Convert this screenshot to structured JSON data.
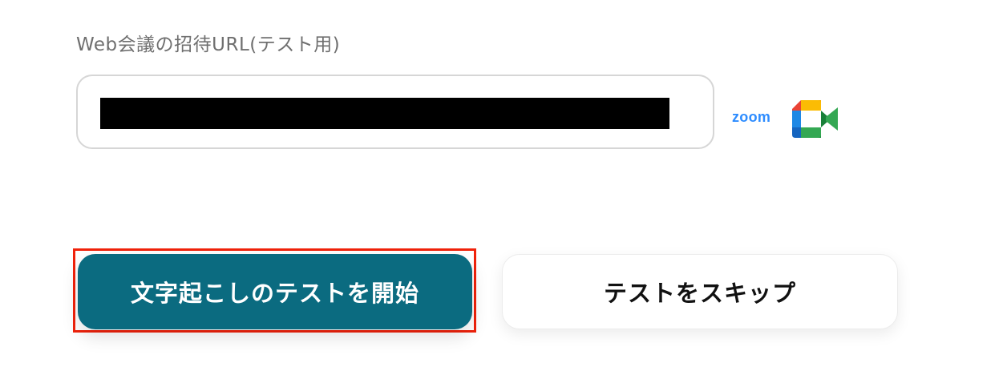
{
  "form": {
    "url_label": "Web会議の招待URL(テスト用)",
    "url_value": ""
  },
  "providers": {
    "zoom_text": "zoom",
    "meet_icon": "google-meet-icon",
    "zoom_color": "#2d8cff"
  },
  "actions": {
    "start_label": "文字起こしのテストを開始",
    "skip_label": "テストをスキップ"
  },
  "colors": {
    "primary": "#0b6b80",
    "highlight": "#f0220b"
  }
}
